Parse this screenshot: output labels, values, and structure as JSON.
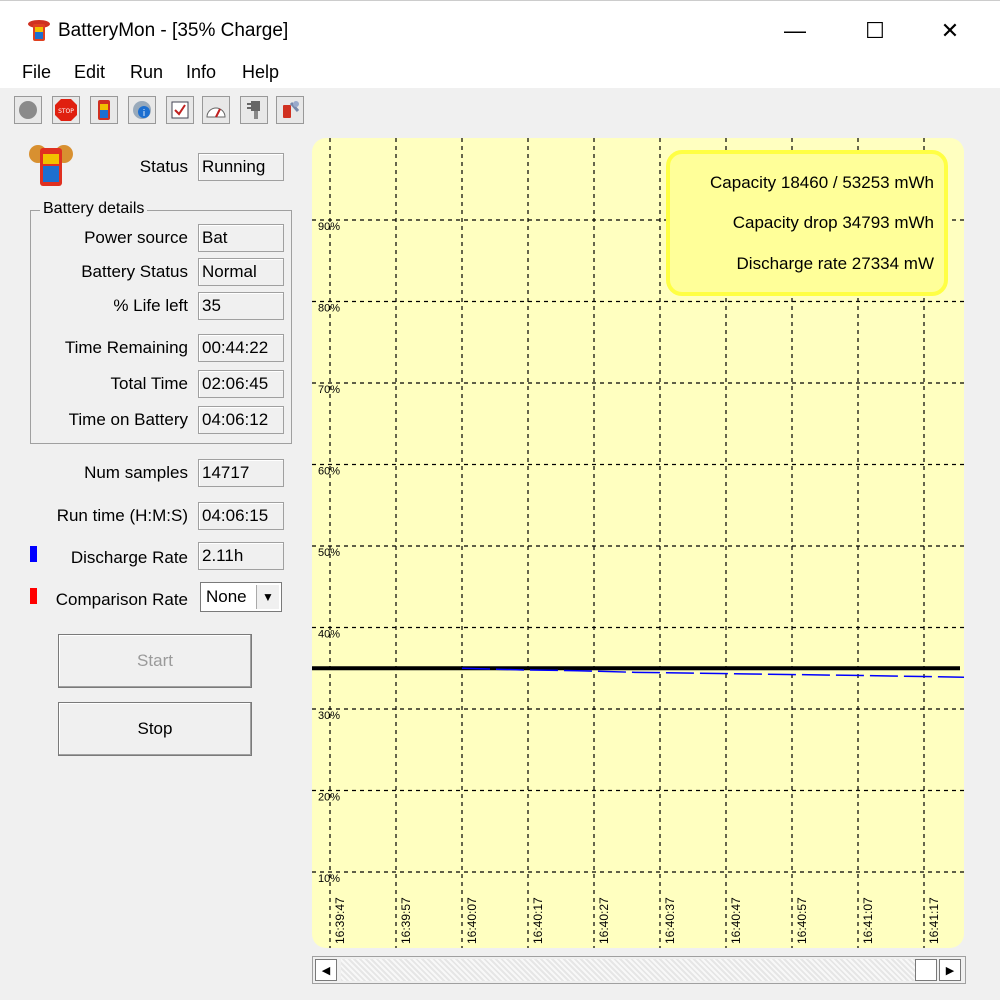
{
  "window": {
    "title": "BatteryMon - [35% Charge]",
    "min_glyph": "—",
    "max_glyph": "☐",
    "close_glyph": "✕"
  },
  "menu": [
    "File",
    "Edit",
    "Run",
    "Info",
    "Help"
  ],
  "toolbar": {
    "icons": [
      "record-icon",
      "stop-icon",
      "battery-icon",
      "battery-info-icon",
      "checklist-icon",
      "gauge-icon",
      "plug-icon",
      "tools-icon"
    ],
    "stop_text": "STOP"
  },
  "status": {
    "label": "Status",
    "value": "Running"
  },
  "battery_details": {
    "title": "Battery details",
    "rows": [
      {
        "label": "Power source",
        "value": "Bat"
      },
      {
        "label": "Battery Status",
        "value": "Normal"
      },
      {
        "label": "% Life left",
        "value": "35"
      },
      {
        "label": "Time Remaining",
        "value": "00:44:22"
      },
      {
        "label": "Total Time",
        "value": "02:06:45"
      },
      {
        "label": "Time on Battery",
        "value": "04:06:12"
      }
    ]
  },
  "stats": {
    "num_samples": {
      "label": "Num samples",
      "value": "14717"
    },
    "run_time": {
      "label": "Run time (H:M:S)",
      "value": "04:06:15"
    },
    "discharge_rate": {
      "label": "Discharge Rate",
      "value": "2.11h",
      "color": "#0000ff"
    },
    "comparison_rate": {
      "label": "Comparison Rate",
      "value": "None",
      "color": "#ff0000"
    }
  },
  "buttons": {
    "start": "Start",
    "stop": "Stop"
  },
  "colors": {
    "chart_bg": "#ffffc0",
    "info_bg": "#ffff99",
    "info_border": "#ffff44"
  },
  "chart_data": {
    "type": "line",
    "x": [
      "16:39:47",
      "16:39:57",
      "16:40:07",
      "16:40:17",
      "16:40:27",
      "16:40:37",
      "16:40:47",
      "16:40:57",
      "16:41:07",
      "16:41:17"
    ],
    "y_ticks": [
      "10%",
      "20%",
      "30%",
      "40%",
      "50%",
      "60%",
      "70%",
      "80%",
      "90%"
    ],
    "ylim": [
      0,
      100
    ],
    "grid": true,
    "series": [
      {
        "color": "#000000",
        "style": "solid",
        "x_start": "16:39:47",
        "x_end": "16:41:17",
        "values": [
          35,
          35
        ]
      },
      {
        "color": "#0000ff",
        "style": "dashed",
        "x_start": "16:40:07",
        "x_end": "16:41:17",
        "values": [
          35,
          34.8,
          34.7,
          34.5,
          34.4,
          34.3,
          34.2,
          34.1,
          33.9
        ]
      }
    ],
    "info": [
      "Capacity 18460 / 53253 mWh",
      "Capacity drop 34793 mWh",
      "Discharge rate 27334 mW"
    ],
    "info_position": "top-right"
  }
}
